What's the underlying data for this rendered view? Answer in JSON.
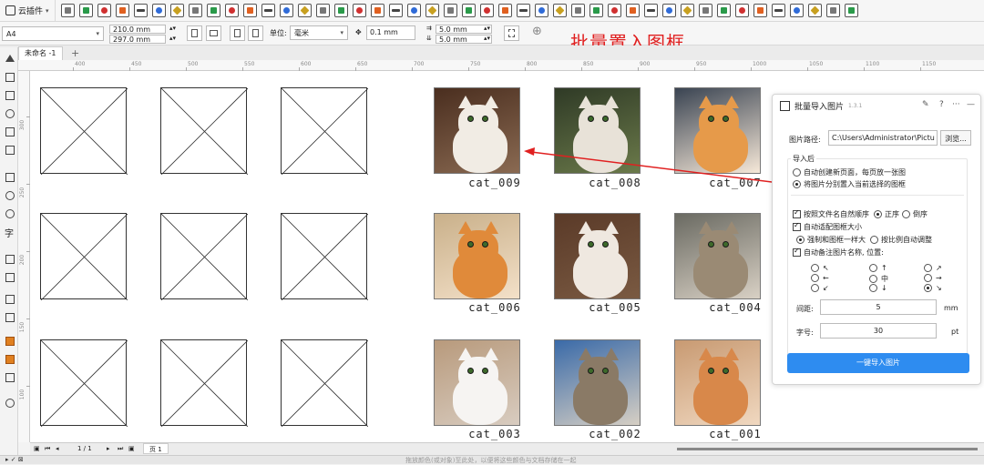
{
  "toolbar": {
    "plugin_menu_label": "云插件",
    "icon_count": 44
  },
  "property_bar": {
    "paper_size": "A4",
    "width": "210.0 mm",
    "height": "297.0 mm",
    "unit_label": "单位:",
    "unit_value": "毫米",
    "nudge": "0.1 mm",
    "dup_x": "5.0 mm",
    "dup_y": "5.0 mm"
  },
  "overlay_title": "批量置入图框",
  "document": {
    "tab_label": "未命名 -1"
  },
  "ruler": {
    "h_ticks": [
      "400",
      "450",
      "500",
      "550",
      "600",
      "650",
      "700",
      "750",
      "800",
      "850",
      "900",
      "950",
      "1000",
      "1050",
      "1100",
      "1150"
    ],
    "v_ticks": [
      "300",
      "250",
      "200",
      "150",
      "100"
    ]
  },
  "images": {
    "captions": [
      "cat_009",
      "cat_008",
      "cat_007",
      "cat_006",
      "cat_005",
      "cat_004",
      "cat_003",
      "cat_002",
      "cat_001"
    ]
  },
  "page_nav": {
    "counter": "1 / 1",
    "page_tab": "页 1"
  },
  "status": {
    "hint": "拖放颜色(或对象)至此处，以便将这些颜色与文档存储在一起"
  },
  "panel": {
    "title": "批量导入图片",
    "version": "1.3.1",
    "pin_icon": "pin-icon",
    "help": "?",
    "more": "···",
    "close": "—",
    "path_label": "图片路径:",
    "path_value": "C:\\Users\\Administrator\\Pictu",
    "browse": "浏览...",
    "group_label": "导入后",
    "opt_new_page": "自动创建新页面，每页放一张图",
    "opt_into_frames": "将图片分别置入当前选择的图框",
    "sort_label": "按照文件名自然顺序",
    "sort_asc": "正序",
    "sort_desc": "倒序",
    "fit_label": "自动适配图框大小",
    "fit_force": "强制和图框一样大",
    "fit_scale": "按比例自动调整",
    "caption_label": "自动备注图片名称, 位置:",
    "pos_arrows": [
      "↖",
      "↑",
      "↗",
      "←",
      "中",
      "→",
      "↙",
      "↓",
      "↘"
    ],
    "spacing_label": "间距:",
    "spacing_value": "5",
    "spacing_unit": "mm",
    "fontsize_label": "字号:",
    "fontsize_value": "30",
    "fontsize_unit": "pt",
    "import_button": "一键导入图片"
  },
  "colors": {
    "accent": "#2e8cf0",
    "annotation": "#e02020"
  }
}
